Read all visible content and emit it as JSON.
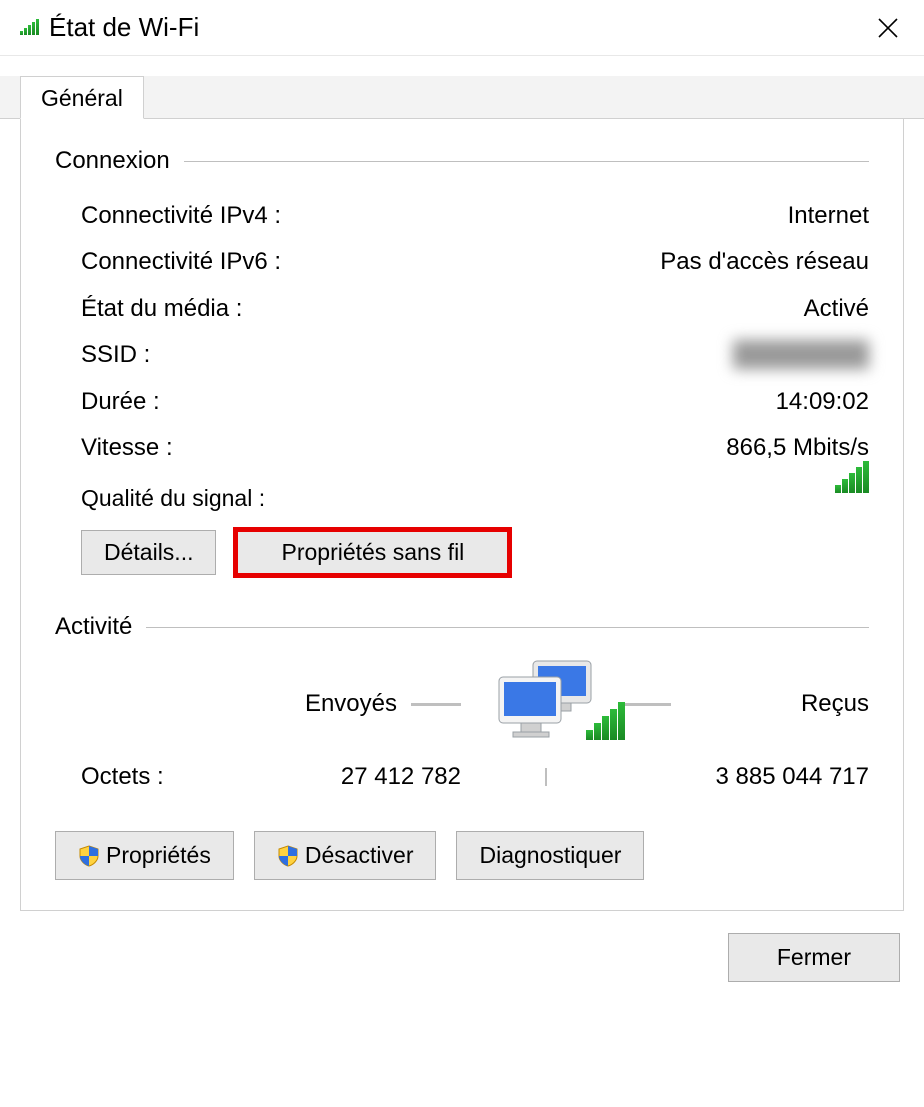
{
  "titlebar": {
    "title": "État de Wi-Fi"
  },
  "tabs": {
    "general": "Général"
  },
  "connection": {
    "heading": "Connexion",
    "rows": {
      "ipv4_label": "Connectivité IPv4 :",
      "ipv4_value": "Internet",
      "ipv6_label": "Connectivité IPv6 :",
      "ipv6_value": "Pas d'accès réseau",
      "media_label": "État du média :",
      "media_value": "Activé",
      "ssid_label": "SSID :",
      "ssid_value": "████████",
      "duration_label": "Durée :",
      "duration_value": "14:09:02",
      "speed_label": "Vitesse :",
      "speed_value": "866,5 Mbits/s",
      "signal_label": "Qualité du signal :"
    },
    "buttons": {
      "details": "Détails...",
      "wireless_props": "Propriétés sans fil"
    }
  },
  "activity": {
    "heading": "Activité",
    "sent_label": "Envoyés",
    "recv_label": "Reçus",
    "bytes_label": "Octets :",
    "bytes_sent": "27 412 782",
    "bytes_recv": "3 885 044 717",
    "buttons": {
      "properties": "Propriétés",
      "disable": "Désactiver",
      "diagnose": "Diagnostiquer"
    }
  },
  "footer": {
    "close": "Fermer"
  }
}
